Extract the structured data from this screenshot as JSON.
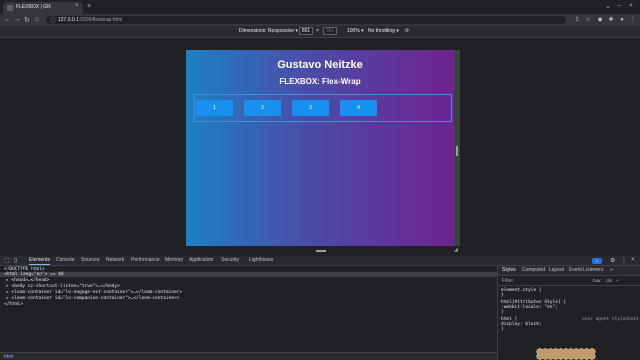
{
  "browser": {
    "tab_title": "FLEXBOX | GN",
    "tab_close": "×",
    "new_tab": "+",
    "url_host": "127.0.0.1",
    "url_path": ":5500/flexwrap.html",
    "icons": [
      "back-icon",
      "forward-icon",
      "reload-icon",
      "home-icon",
      "info-icon",
      "share-icon",
      "star-icon",
      "extensions-icon",
      "puzzle-icon",
      "profile-icon",
      "menu-icon"
    ]
  },
  "device_toolbar": {
    "dimensions_label": "Dimensions: Responsive ▾",
    "width": "801",
    "height": "381",
    "times": "×",
    "zoom": "100% ▾",
    "throttle": "No throttling ▾"
  },
  "page": {
    "title": "Gustavo Neitzke",
    "subtitle": "FLEXBOX: Flex-Wrap",
    "boxes": [
      "1",
      "2",
      "3",
      "4"
    ],
    "gradient_start": "#1d80c4",
    "gradient_end": "#6f2390",
    "box_color": "#1890f0"
  },
  "devtools": {
    "tabs": [
      "Elements",
      "Console",
      "Sources",
      "Network",
      "Performance",
      "Memory",
      "Application",
      "Security",
      "Lighthouse"
    ],
    "more": "»",
    "issues_badge": "1",
    "elements_lines": [
      "<!DOCTYPE html>",
      "<html lang=\"en\"> == $0",
      "▸ <head>…</head>",
      "▸ <body cz-shortcut-listen=\"true\">…</body>",
      "▸ <loom-container id=\"lo-engage-ext-container\">…</loom-container>",
      "▸ <loom-container id=\"lo-companion-container\">…</loom-container>",
      "</html>"
    ],
    "breadcrumb": "html",
    "styles_tabs": [
      "Styles",
      "Computed",
      "Layout",
      "Event Listeners",
      "»"
    ],
    "filter_placeholder": "Filter",
    "filter_buttons": [
      ":hov",
      ".cls",
      "+"
    ],
    "styles_lines": [
      "element.style {",
      "}",
      "html[Attributes Style] {",
      "  -webkit-locale: \"en\";",
      "}",
      "html {",
      "  display: block;",
      "}"
    ],
    "user_agent_label": "user agent stylesheet"
  }
}
